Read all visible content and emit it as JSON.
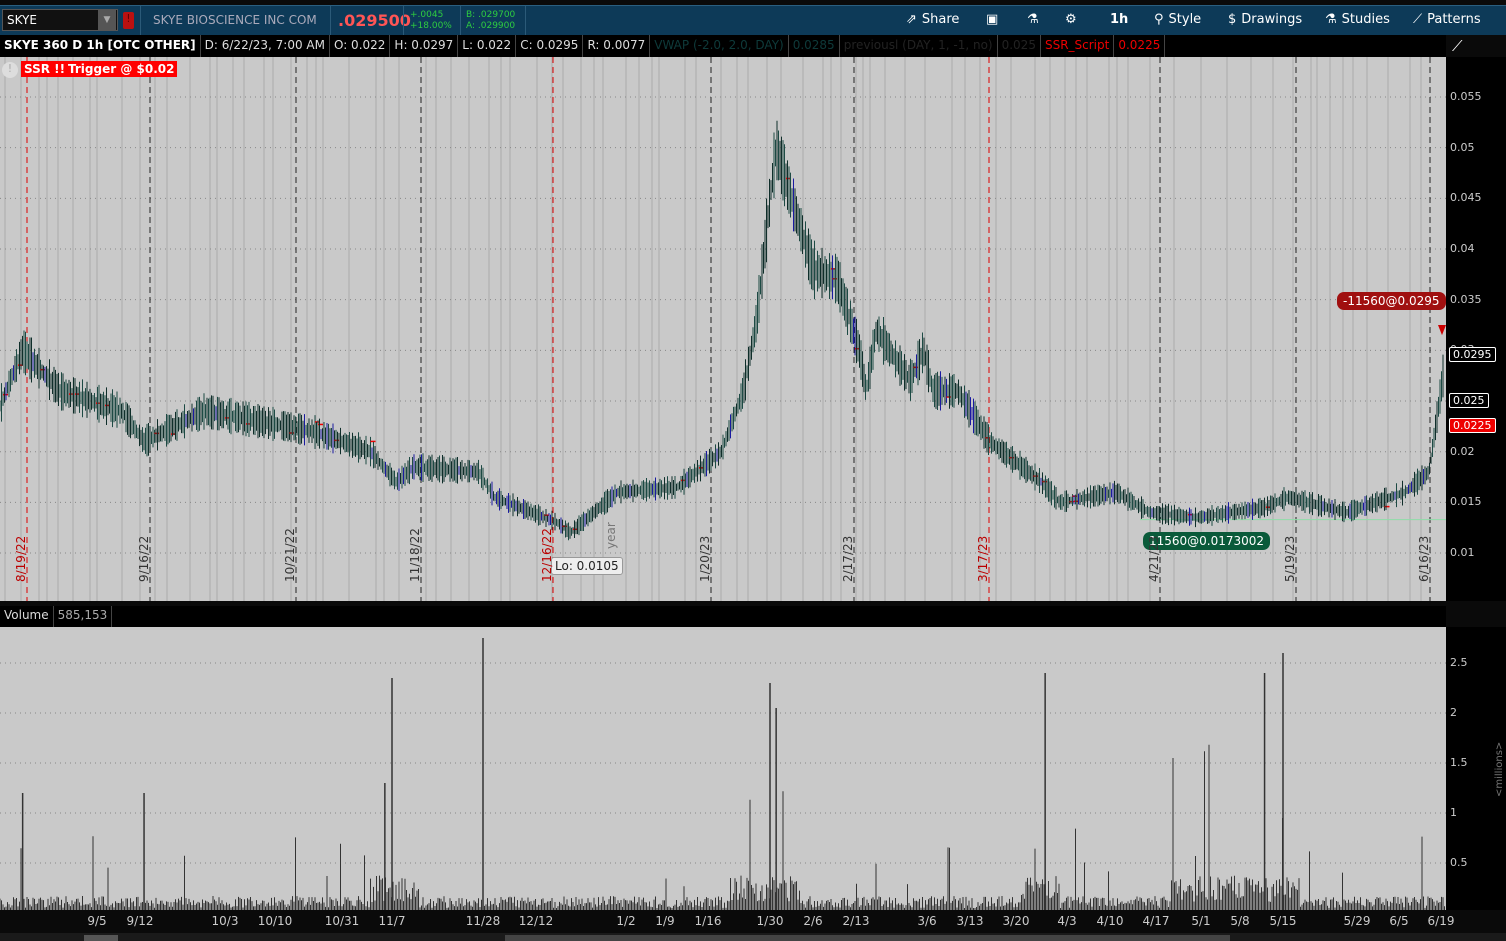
{
  "toolbar": {
    "symbol": "SKYE",
    "company": "SKYE BIOSCIENCE INC COM",
    "last": ".029500",
    "change": "+.0045",
    "change_pct": "+18.00%",
    "bid": "B: .029700",
    "ask": "A: .029900",
    "share": "Share",
    "timeframe": "1h",
    "style": "Style",
    "drawings": "Drawings",
    "studies": "Studies",
    "patterns": "Patterns"
  },
  "info": {
    "title": "SKYE 360 D 1h [OTC OTHER]",
    "date": "D: 6/22/23, 7:00 AM",
    "open": "O: 0.022",
    "high": "H: 0.0297",
    "low": "L: 0.022",
    "close": "C: 0.0295",
    "range": "R: 0.0077",
    "vwap": "VWAP (-2.0, 2.0, DAY)",
    "vwap_val": "0.0285",
    "prev": "previousl (DAY, 1, -1, no)",
    "prev_val": "0.025",
    "ssr": "SSR_Script",
    "ssr_val": "0.0225"
  },
  "alerts": {
    "ssr": "SSR !!!",
    "trigger": "Trigger @ $0.02"
  },
  "annotations": {
    "sell": "-11560@0.0295",
    "buy": "11560@0.0173002",
    "low": "Lo: 0.0105",
    "year": "year"
  },
  "volume": {
    "label": "Volume",
    "value": "585,153",
    "unit": "<millions>"
  },
  "colors": {
    "up": "#1a5a4a",
    "down": "#1a1aa0",
    "red": "#e00000",
    "buy": "#0a5a3a",
    "sell": "#a01010"
  },
  "chart_data": {
    "type": "line",
    "title": "SKYE 360 D 1h",
    "ylim": [
      0.005,
      0.058
    ],
    "yticks": [
      "0.055",
      "0.05",
      "0.045",
      "0.04",
      "0.035",
      "0.03",
      "0.025",
      "0.02",
      "0.015",
      "0.01"
    ],
    "price_labels": {
      "last": "0.0295",
      "prev": "0.025",
      "ssr": "0.0225"
    },
    "date_markers": [
      {
        "label": "8/19/22",
        "red": true
      },
      {
        "label": "9/16/22",
        "red": false
      },
      {
        "label": "10/21/22",
        "red": false
      },
      {
        "label": "11/18/22",
        "red": false
      },
      {
        "label": "12/16/22",
        "red": true
      },
      {
        "label": "1/20/23",
        "red": false
      },
      {
        "label": "2/17/23",
        "red": false
      },
      {
        "label": "3/17/23",
        "red": true
      },
      {
        "label": "4/21/23",
        "red": false
      },
      {
        "label": "5/19/23",
        "red": false
      },
      {
        "label": "6/16/23",
        "red": false
      }
    ],
    "xticks": [
      "9/5",
      "9/12",
      "10/3",
      "10/10",
      "10/31",
      "11/7",
      "11/28",
      "12/12",
      "1/2",
      "1/9",
      "1/16",
      "1/30",
      "2/6",
      "2/13",
      "3/6",
      "3/13",
      "3/20",
      "4/3",
      "4/10",
      "4/17",
      "5/1",
      "5/8",
      "5/15",
      "5/29",
      "6/5",
      "6/19"
    ],
    "price": [
      [
        "2022-08-15",
        0.0245
      ],
      [
        "2022-08-20",
        0.03
      ],
      [
        "2022-08-28",
        0.026
      ],
      [
        "2022-09-09",
        0.024
      ],
      [
        "2022-09-13",
        0.021
      ],
      [
        "2022-09-28",
        0.024
      ],
      [
        "2022-10-22",
        0.022
      ],
      [
        "2022-11-04",
        0.02
      ],
      [
        "2022-11-08",
        0.017
      ],
      [
        "2022-11-12",
        0.0185
      ],
      [
        "2022-11-27",
        0.018
      ],
      [
        "2022-12-01",
        0.0155
      ],
      [
        "2022-12-17",
        0.013
      ],
      [
        "2022-12-20",
        0.012
      ],
      [
        "2022-12-31",
        0.016
      ],
      [
        "2023-01-11",
        0.0165
      ],
      [
        "2023-01-19",
        0.02
      ],
      [
        "2023-01-24",
        0.026
      ],
      [
        "2023-01-27",
        0.033
      ],
      [
        "2023-01-30",
        0.045
      ],
      [
        "2023-01-31",
        0.05
      ],
      [
        "2023-02-03",
        0.044
      ],
      [
        "2023-02-06",
        0.038
      ],
      [
        "2023-02-10",
        0.037
      ],
      [
        "2023-02-14",
        0.03
      ],
      [
        "2023-02-16",
        0.026
      ],
      [
        "2023-02-19",
        0.032
      ],
      [
        "2023-03-01",
        0.027
      ],
      [
        "2023-03-05",
        0.03
      ],
      [
        "2023-03-07",
        0.026
      ],
      [
        "2023-03-11",
        0.026
      ],
      [
        "2023-03-16",
        0.021
      ],
      [
        "2023-03-27",
        0.017
      ],
      [
        "2023-04-01",
        0.015
      ],
      [
        "2023-04-11",
        0.016
      ],
      [
        "2023-04-16",
        0.014
      ],
      [
        "2023-04-30",
        0.0135
      ],
      [
        "2023-05-12",
        0.0145
      ],
      [
        "2023-05-16",
        0.0155
      ],
      [
        "2023-05-27",
        0.014
      ],
      [
        "2023-06-07",
        0.016
      ],
      [
        "2023-06-15",
        0.018
      ],
      [
        "2023-06-22",
        0.0295
      ]
    ],
    "volume_ylim": [
      0,
      2.8
    ],
    "volume_yticks": [
      "2.5",
      "2",
      "1.5",
      "1",
      "0.5"
    ],
    "volume_spikes": [
      [
        "2022-11-07",
        2.35
      ],
      [
        "2022-11-28",
        2.75
      ],
      [
        "2023-01-30",
        2.3
      ],
      [
        "2023-01-31",
        2.05
      ],
      [
        "2023-03-28",
        2.4
      ],
      [
        "2023-05-12",
        2.4
      ],
      [
        "2023-05-15",
        2.6
      ],
      [
        "2022-08-20",
        1.2
      ],
      [
        "2022-09-13",
        1.2
      ],
      [
        "2022-11-06",
        1.3
      ]
    ]
  }
}
